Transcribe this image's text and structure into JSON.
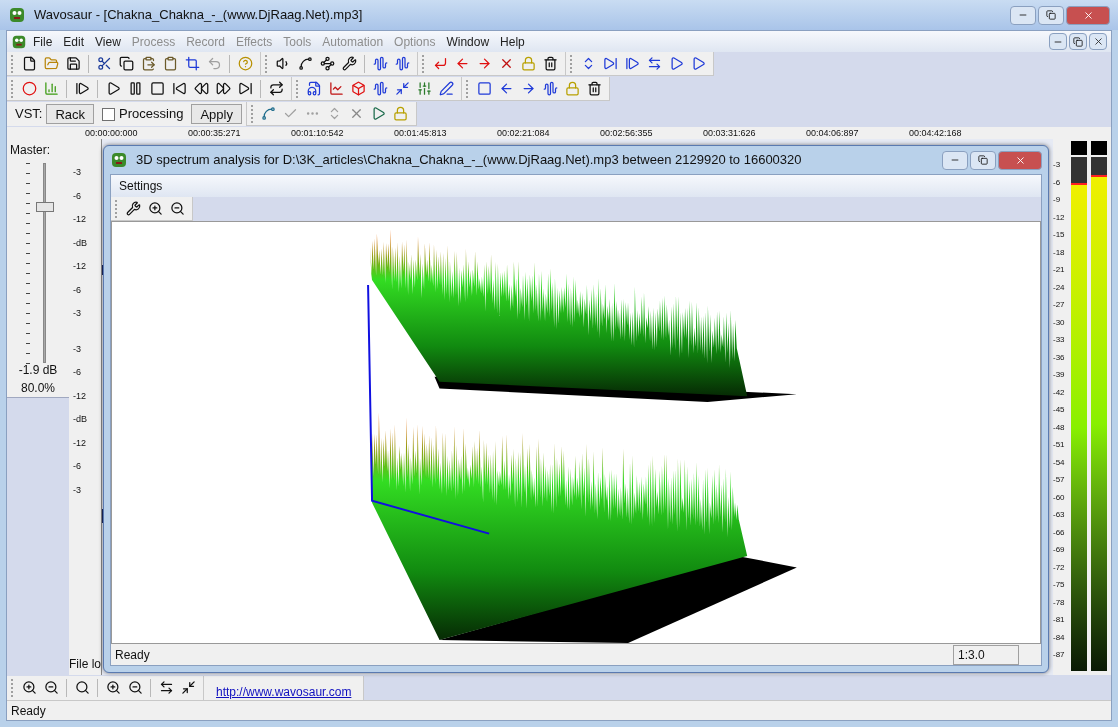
{
  "window": {
    "title": "Wavosaur - [Chakna_Chakna_-_(www.DjRaag.Net).mp3]"
  },
  "menu": [
    {
      "label": "File",
      "disabled": false
    },
    {
      "label": "Edit",
      "disabled": false
    },
    {
      "label": "View",
      "disabled": false
    },
    {
      "label": "Process",
      "disabled": true
    },
    {
      "label": "Record",
      "disabled": true
    },
    {
      "label": "Effects",
      "disabled": true
    },
    {
      "label": "Tools",
      "disabled": true
    },
    {
      "label": "Automation",
      "disabled": true
    },
    {
      "label": "Options",
      "disabled": true
    },
    {
      "label": "Window",
      "disabled": false
    },
    {
      "label": "Help",
      "disabled": false
    }
  ],
  "vst_bar": {
    "label": "VST:",
    "rack_button": "Rack",
    "processing": {
      "label": "Processing",
      "checked": false
    },
    "apply_button": "Apply"
  },
  "timeline": [
    "00:00:00:000",
    "00:00:35:271",
    "00:01:10:542",
    "00:01:45:813",
    "00:02:21:084",
    "00:02:56:355",
    "00:03:31:626",
    "00:04:06:897",
    "00:04:42:168"
  ],
  "master": {
    "label": "Master:",
    "level": 0.8,
    "reading_db": "-1.9 dB",
    "reading_percent": "80.0%"
  },
  "channel_scale": [
    "-3",
    "-6",
    "-12",
    "-dB",
    "-12",
    "-6",
    "-3",
    "-3",
    "-6",
    "-12",
    "-dB",
    "-12",
    "-6",
    "-3"
  ],
  "file_log_label": "File lo",
  "link": "http://www.wavosaur.com",
  "meter_scale": [
    "-3",
    "-6",
    "-9",
    "-12",
    "-15",
    "-18",
    "-21",
    "-24",
    "-27",
    "-30",
    "-33",
    "-36",
    "-39",
    "-42",
    "-45",
    "-48",
    "-51",
    "-54",
    "-57",
    "-60",
    "-63",
    "-66",
    "-69",
    "-72",
    "-75",
    "-78",
    "-81",
    "-84",
    "-87"
  ],
  "meters": [
    {
      "level": 0.95
    },
    {
      "level": 0.965
    }
  ],
  "status_bar": {
    "text": "Ready"
  },
  "dialog": {
    "title": "3D spectrum analysis for D:\\3K_articles\\Chakna_Chakna_-_(www.DjRaag.Net).mp3 between 2129920 to 16600320",
    "menu": [
      "Settings"
    ],
    "status": "Ready",
    "zoom": "1:3.0"
  }
}
